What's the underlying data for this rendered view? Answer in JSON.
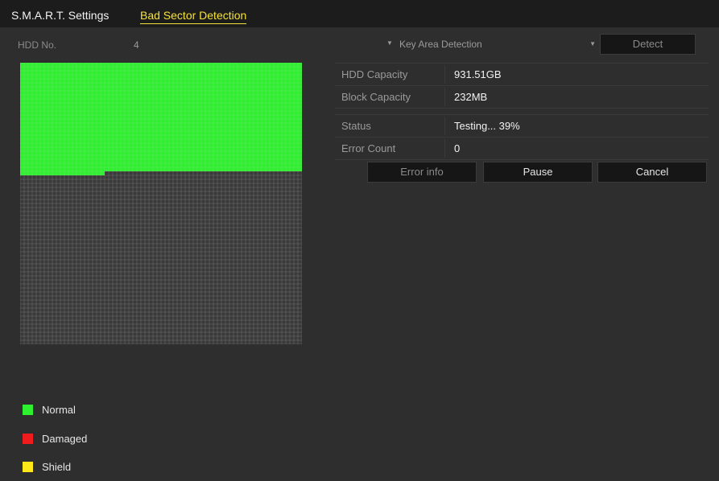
{
  "tabs": {
    "smart": "S.M.A.R.T. Settings",
    "bad_sector": "Bad Sector Detection"
  },
  "hdd": {
    "label": "HDD No.",
    "value": "4"
  },
  "detection_mode": {
    "selected": "Key Area Detection"
  },
  "buttons": {
    "detect": "Detect",
    "error_info": "Error info",
    "pause": "Pause",
    "cancel": "Cancel"
  },
  "info": {
    "hdd_capacity_label": "HDD Capacity",
    "hdd_capacity": "931.51GB",
    "block_capacity_label": "Block Capacity",
    "block_capacity": "232MB",
    "status_label": "Status",
    "status": "Testing... 39%",
    "error_count_label": "Error Count",
    "error_count": "0"
  },
  "sector_map": {
    "progress": 0.39,
    "normal_color": "#2ef02e",
    "pending_color": "#3a3a3a"
  },
  "legend": [
    {
      "label": "Normal",
      "color": "#2ef02e"
    },
    {
      "label": "Damaged",
      "color": "#ee1c1c"
    },
    {
      "label": "Shield",
      "color": "#ffe81a"
    }
  ]
}
